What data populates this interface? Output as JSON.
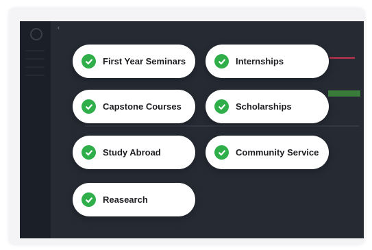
{
  "screen": {
    "back_glyph": "‹"
  },
  "options": [
    {
      "label": "First Year Seminars",
      "icon": "check-circle-icon",
      "checked": true
    },
    {
      "label": "Internships",
      "icon": "check-circle-icon",
      "checked": true
    },
    {
      "label": "Capstone Courses",
      "icon": "check-circle-icon",
      "checked": true
    },
    {
      "label": "Scholarships",
      "icon": "check-circle-icon",
      "checked": true
    },
    {
      "label": "Study Abroad",
      "icon": "check-circle-icon",
      "checked": true
    },
    {
      "label": "Community Service",
      "icon": "check-circle-icon",
      "checked": true
    },
    {
      "label": "Reasearch",
      "icon": "check-circle-icon",
      "checked": true
    }
  ],
  "colors": {
    "check": "#2fae4a",
    "pill": "#ffffff",
    "label": "#1d1d22",
    "screen_bg": "#252a33"
  }
}
